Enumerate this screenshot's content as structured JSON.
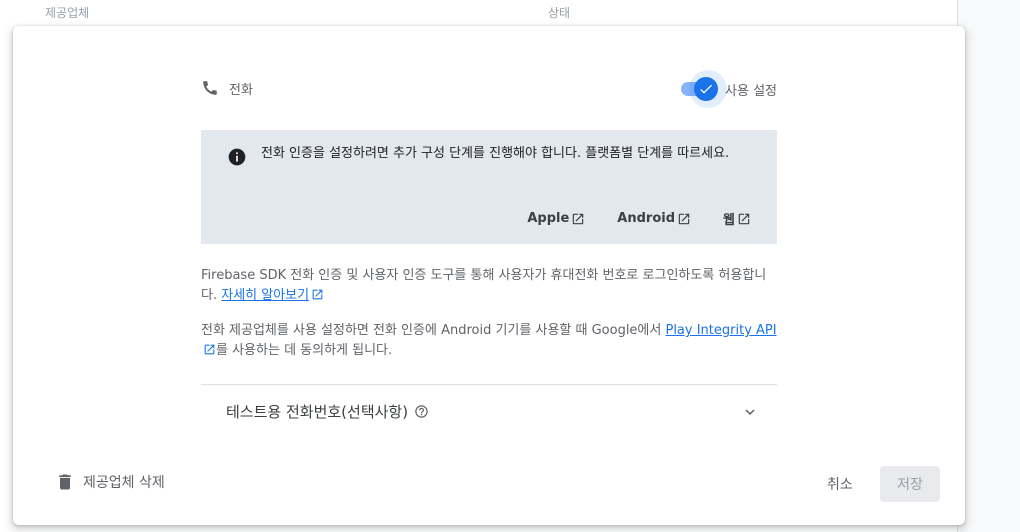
{
  "background_table": {
    "col_provider": "제공업체",
    "col_status": "상태"
  },
  "provider": {
    "name": "전화",
    "icon": "phone-icon",
    "toggle_label": "사용 설정",
    "enabled": true
  },
  "info": {
    "text": "전화 인증을 설정하려면 추가 구성 단계를 진행해야 합니다. 플랫폼별 단계를 따르세요.",
    "links": [
      {
        "label": "Apple"
      },
      {
        "label": "Android"
      },
      {
        "label": "웹"
      }
    ]
  },
  "description1": {
    "text": "Firebase SDK 전화 인증 및 사용자 인증 도구를 통해 사용자가 휴대전화 번호로 로그인하도록 허용합니다. ",
    "link": "자세히 알아보기"
  },
  "description2": {
    "text_before": "전화 제공업체를 사용 설정하면 전화 인증에 Android 기기를 사용할 때 Google에서 ",
    "link": "Play Integrity API",
    "text_after": "를 사용하는 데 동의하게 됩니다."
  },
  "test_numbers": {
    "label": "테스트용 전화번호(선택사항)"
  },
  "footer": {
    "delete_label": "제공업체 삭제",
    "cancel_label": "취소",
    "save_label": "저장"
  },
  "colors": {
    "accent": "#1a73e8",
    "info_bg": "#e3e8ef"
  }
}
